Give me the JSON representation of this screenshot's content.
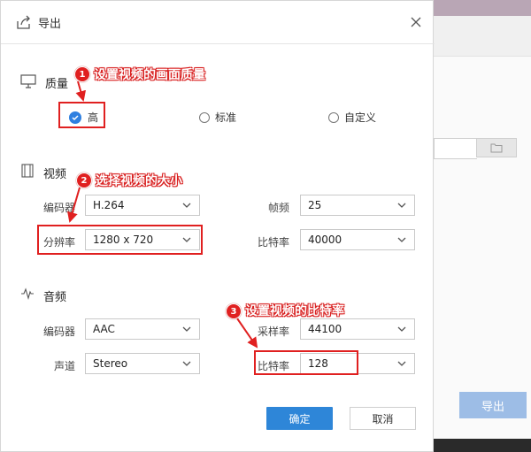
{
  "dialog": {
    "title": "导出",
    "close_glyph": "✕",
    "quality": {
      "label": "质量",
      "options": [
        "高",
        "标准",
        "自定义"
      ],
      "selected": "高"
    },
    "video": {
      "label": "视频",
      "encoder_label": "编码器",
      "encoder_value": "H.264",
      "framerate_label": "帧频",
      "framerate_value": "25",
      "resolution_label": "分辨率",
      "resolution_value": "1280 x 720",
      "bitrate_label": "比特率",
      "bitrate_value": "40000"
    },
    "audio": {
      "label": "音频",
      "encoder_label": "编码器",
      "encoder_value": "AAC",
      "samplerate_label": "采样率",
      "samplerate_value": "44100",
      "channel_label": "声道",
      "channel_value": "Stereo",
      "bitrate_label": "比特率",
      "bitrate_value": "128"
    },
    "confirm_label": "确定",
    "cancel_label": "取消"
  },
  "background_app": {
    "export_label": "导出"
  },
  "annotations": [
    {
      "num": "1",
      "text": "设置视频的画面质量"
    },
    {
      "num": "2",
      "text": "选择视频的大小"
    },
    {
      "num": "3",
      "text": "设置视频的比特率"
    }
  ],
  "colors": {
    "accent": "#2e86d8",
    "annotation_red": "#e02020"
  },
  "icons": [
    "export-icon",
    "close-icon",
    "monitor-icon",
    "film-icon",
    "audio-wave-icon",
    "chevron-down-icon",
    "folder-icon",
    "check-icon"
  ]
}
